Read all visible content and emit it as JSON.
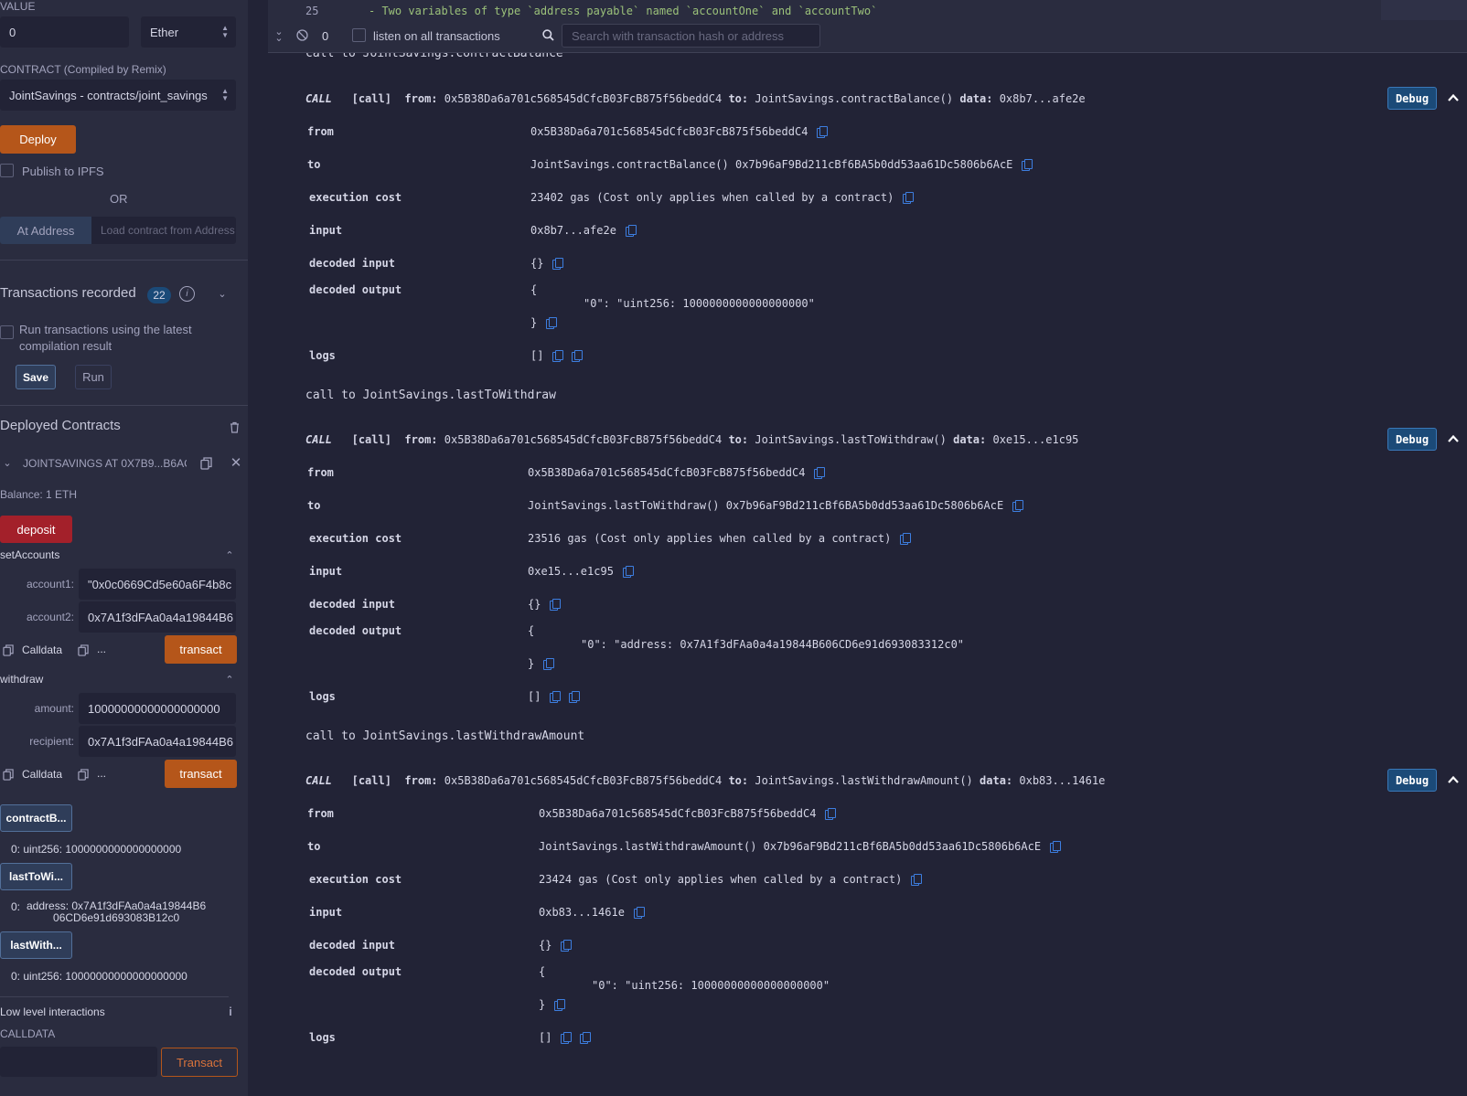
{
  "left": {
    "value_label": "VALUE",
    "value_input": "0",
    "unit_select": "Ether",
    "contract_label": "CONTRACT (Compiled by Remix)",
    "contract_select": "JointSavings - contracts/joint_savings",
    "deploy_label": "Deploy",
    "publish_ipfs_label": "Publish to IPFS",
    "or_label": "OR",
    "at_address_label": "At Address",
    "at_address_placeholder": "Load contract from Address",
    "tx_recorded_label": "Transactions recorded",
    "tx_recorded_count": "22",
    "run_latest_label_1": "Run transactions using the latest",
    "run_latest_label_2": "compilation result",
    "save_label": "Save",
    "run_label": "Run",
    "deployed_contracts_label": "Deployed Contracts",
    "instance_title": "JOINTSAVINGS AT 0X7B9...B6AC",
    "balance_label": "Balance: 1 ETH",
    "deposit_label": "deposit",
    "set_accounts": {
      "title": "setAccounts",
      "account1_label": "account1:",
      "account1_value": "\"0x0c0669Cd5e60a6F4b8c",
      "account2_label": "account2:",
      "account2_value": "0x7A1f3dFAa0a4a19844B6",
      "calldata_label": "Calldata",
      "more_label": "...",
      "transact_label": "transact"
    },
    "withdraw": {
      "title": "withdraw",
      "amount_label": "amount:",
      "amount_value": "10000000000000000000",
      "recipient_label": "recipient:",
      "recipient_value": "0x7A1f3dFAa0a4a19844B6",
      "calldata_label": "Calldata",
      "more_label": "...",
      "transact_label": "transact"
    },
    "contract_balance_btn": "contractB...",
    "contract_balance_out": "0: uint256: 1000000000000000000",
    "last_to_withdraw_btn": "lastToWi...",
    "last_to_withdraw_out_prefix": "0:",
    "last_to_withdraw_out_1": "address: 0x7A1f3dFAa0a4a19844B6",
    "last_to_withdraw_out_2": "06CD6e91d693083B12c0",
    "last_withdraw_amount_btn": "lastWith...",
    "last_withdraw_amount_out": "0: uint256: 10000000000000000000",
    "low_level_label": "Low level interactions",
    "calldata_label": "CALLDATA",
    "transact_label": "Transact"
  },
  "editor": {
    "line_number": "25",
    "line_text": "- Two variables of type `address payable` named `accountOne` and `accountTwo`"
  },
  "terminal_bar": {
    "count": "0",
    "listen_label": "listen on all transactions",
    "search_placeholder": "Search with transaction hash or address"
  },
  "terminal": {
    "top_partial": "call to JointSavings.contractBalance",
    "blocks": [
      {
        "call_header": "call to JointSavings.contractBalance",
        "summary_kind": "CALL",
        "summary_type": "[call]",
        "summary_from_label": "from:",
        "summary_from": "0x5B38Da6a701c568545dCfcB03FcB875f56beddC4",
        "summary_to_label": "to:",
        "summary_to": "JointSavings.contractBalance()",
        "summary_data_label": "data:",
        "summary_data": "0x8b7...afe2e",
        "debug_label": "Debug",
        "rows": {
          "from_k": "from",
          "from_v": "0x5B38Da6a701c568545dCfcB03FcB875f56beddC4",
          "to_k": "to",
          "to_v": "JointSavings.contractBalance() 0x7b96aF9Bd211cBf6BA5b0dd53aa61Dc5806b6AcE",
          "cost_k": "execution cost",
          "cost_v": "23402 gas (Cost only applies when called by a contract)",
          "input_k": "input",
          "input_v": "0x8b7...afe2e",
          "dinput_k": "decoded input",
          "dinput_v": "{}",
          "doutput_k": "decoded output",
          "doutput_open": "{",
          "doutput_line": "\"0\": \"uint256: 1000000000000000000\"",
          "doutput_close": "}",
          "logs_k": "logs",
          "logs_v": "[]"
        }
      },
      {
        "call_header": "call to JointSavings.lastToWithdraw",
        "summary_kind": "CALL",
        "summary_type": "[call]",
        "summary_from_label": "from:",
        "summary_from": "0x5B38Da6a701c568545dCfcB03FcB875f56beddC4",
        "summary_to_label": "to:",
        "summary_to": "JointSavings.lastToWithdraw()",
        "summary_data_label": "data:",
        "summary_data": "0xe15...e1c95",
        "debug_label": "Debug",
        "rows": {
          "from_k": "from",
          "from_v": "0x5B38Da6a701c568545dCfcB03FcB875f56beddC4",
          "to_k": "to",
          "to_v": "JointSavings.lastToWithdraw() 0x7b96aF9Bd211cBf6BA5b0dd53aa61Dc5806b6AcE",
          "cost_k": "execution cost",
          "cost_v": "23516 gas (Cost only applies when called by a contract)",
          "input_k": "input",
          "input_v": "0xe15...e1c95",
          "dinput_k": "decoded input",
          "dinput_v": "{}",
          "doutput_k": "decoded output",
          "doutput_open": "{",
          "doutput_line": "\"0\": \"address: 0x7A1f3dFAa0a4a19844B606CD6e91d693083312c0\"",
          "doutput_close": "}",
          "logs_k": "logs",
          "logs_v": "[]"
        }
      },
      {
        "call_header": "call to JointSavings.lastWithdrawAmount",
        "summary_kind": "CALL",
        "summary_type": "[call]",
        "summary_from_label": "from:",
        "summary_from": "0x5B38Da6a701c568545dCfcB03FcB875f56beddC4",
        "summary_to_label": "to:",
        "summary_to": "JointSavings.lastWithdrawAmount()",
        "summary_data_label": "data:",
        "summary_data": "0xb83...1461e",
        "debug_label": "Debug",
        "rows": {
          "from_k": "from",
          "from_v": "0x5B38Da6a701c568545dCfcB03FcB875f56beddC4",
          "to_k": "to",
          "to_v": "JointSavings.lastWithdrawAmount() 0x7b96aF9Bd211cBf6BA5b0dd53aa61Dc5806b6AcE",
          "cost_k": "execution cost",
          "cost_v": "23424 gas (Cost only applies when called by a contract)",
          "input_k": "input",
          "input_v": "0xb83...1461e",
          "dinput_k": "decoded input",
          "dinput_v": "{}",
          "doutput_k": "decoded output",
          "doutput_open": "{",
          "doutput_line": "\"0\": \"uint256: 10000000000000000000\"",
          "doutput_close": "}",
          "logs_k": "logs",
          "logs_v": "[]"
        }
      }
    ]
  }
}
